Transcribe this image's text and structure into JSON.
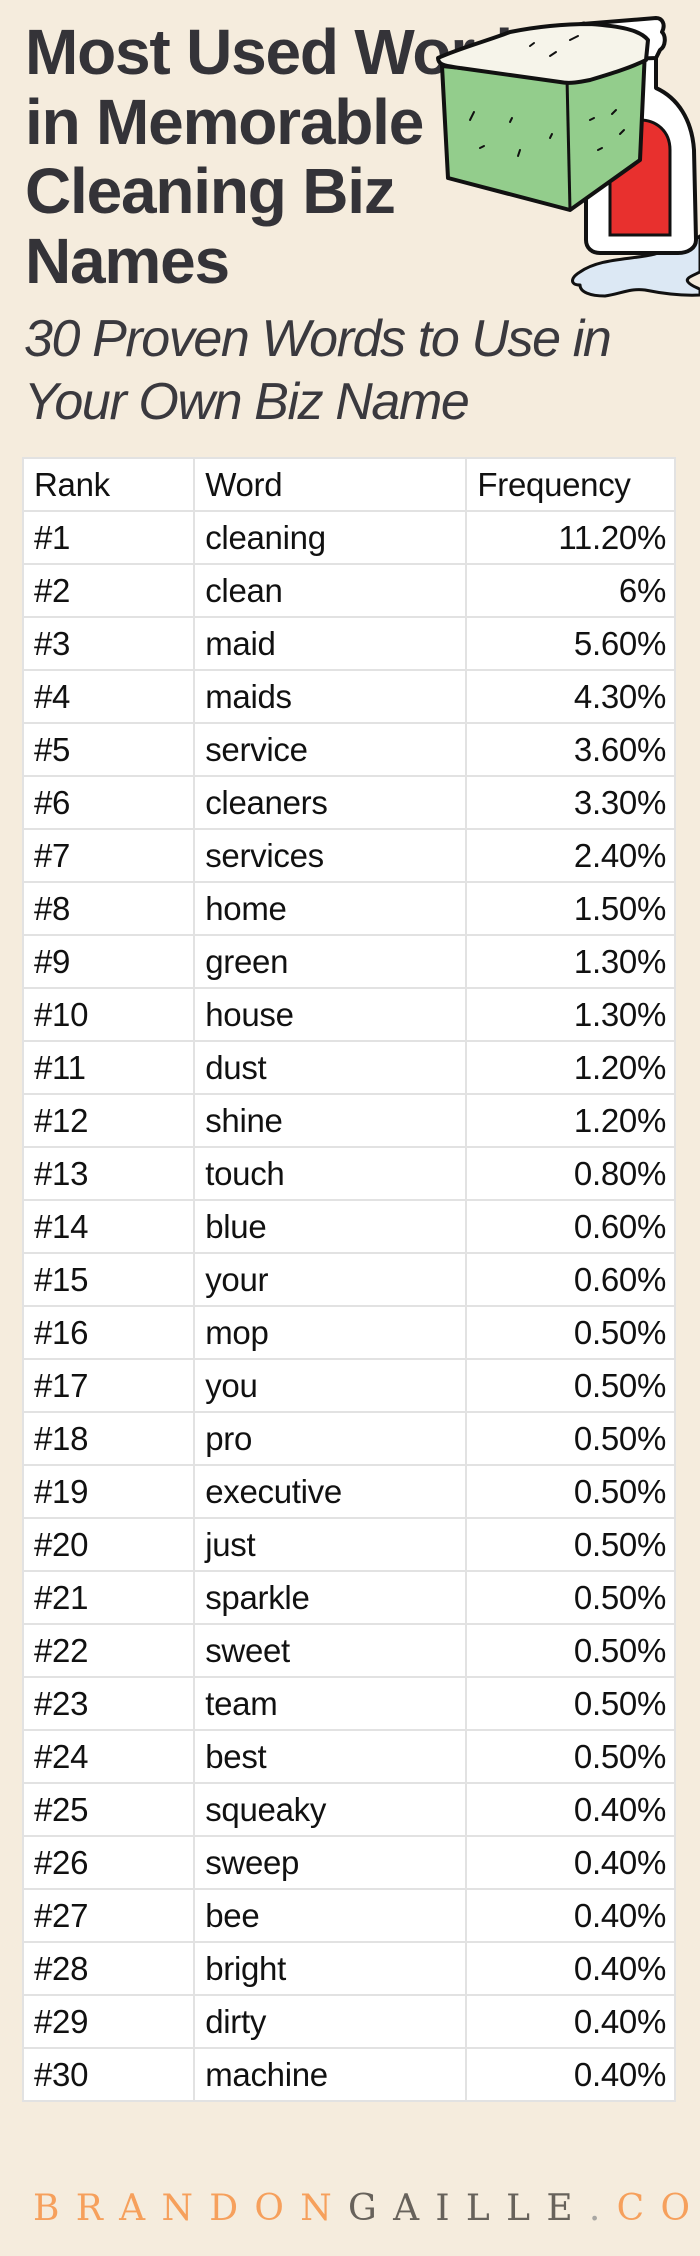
{
  "header": {
    "title_lines": [
      "Most Used Words",
      "in Memorable",
      "Cleaning Biz",
      "Names"
    ],
    "subtitle_lines": [
      "30 Proven Words to Use in",
      "Your Own Biz Name"
    ],
    "illustration": "spray-bottle-and-sponge"
  },
  "colors": {
    "background": "#f5ecdd",
    "title_text": "#343338",
    "brand_orange": "#f6a05c",
    "brand_gray": "#67625b",
    "sponge_green": "#93cd8c",
    "bottle_red": "#e8302e",
    "puddle_blue": "#dce8f4"
  },
  "table": {
    "columns": [
      "Rank",
      "Word",
      "Frequency"
    ],
    "rows": [
      {
        "rank": "#1",
        "word": "cleaning",
        "frequency": "11.20%"
      },
      {
        "rank": "#2",
        "word": "clean",
        "frequency": "6%"
      },
      {
        "rank": "#3",
        "word": "maid",
        "frequency": "5.60%"
      },
      {
        "rank": "#4",
        "word": "maids",
        "frequency": "4.30%"
      },
      {
        "rank": "#5",
        "word": "service",
        "frequency": "3.60%"
      },
      {
        "rank": "#6",
        "word": "cleaners",
        "frequency": "3.30%"
      },
      {
        "rank": "#7",
        "word": "services",
        "frequency": "2.40%"
      },
      {
        "rank": "#8",
        "word": "home",
        "frequency": "1.50%"
      },
      {
        "rank": "#9",
        "word": "green",
        "frequency": "1.30%"
      },
      {
        "rank": "#10",
        "word": "house",
        "frequency": "1.30%"
      },
      {
        "rank": "#11",
        "word": "dust",
        "frequency": "1.20%"
      },
      {
        "rank": "#12",
        "word": "shine",
        "frequency": "1.20%"
      },
      {
        "rank": "#13",
        "word": "touch",
        "frequency": "0.80%"
      },
      {
        "rank": "#14",
        "word": "blue",
        "frequency": "0.60%"
      },
      {
        "rank": "#15",
        "word": "your",
        "frequency": "0.60%"
      },
      {
        "rank": "#16",
        "word": "mop",
        "frequency": "0.50%"
      },
      {
        "rank": "#17",
        "word": "you",
        "frequency": "0.50%"
      },
      {
        "rank": "#18",
        "word": "pro",
        "frequency": "0.50%"
      },
      {
        "rank": "#19",
        "word": "executive",
        "frequency": "0.50%"
      },
      {
        "rank": "#20",
        "word": "just",
        "frequency": "0.50%"
      },
      {
        "rank": "#21",
        "word": "sparkle",
        "frequency": "0.50%"
      },
      {
        "rank": "#22",
        "word": "sweet",
        "frequency": "0.50%"
      },
      {
        "rank": "#23",
        "word": "team",
        "frequency": "0.50%"
      },
      {
        "rank": "#24",
        "word": "best",
        "frequency": "0.50%"
      },
      {
        "rank": "#25",
        "word": "squeaky",
        "frequency": "0.40%"
      },
      {
        "rank": "#26",
        "word": "sweep",
        "frequency": "0.40%"
      },
      {
        "rank": "#27",
        "word": "bee",
        "frequency": "0.40%"
      },
      {
        "rank": "#28",
        "word": "bright",
        "frequency": "0.40%"
      },
      {
        "rank": "#29",
        "word": "dirty",
        "frequency": "0.40%"
      },
      {
        "rank": "#30",
        "word": "machine",
        "frequency": "0.40%"
      }
    ]
  },
  "footer": {
    "brand_part1": "BRANDON",
    "brand_part2": "GAILLE",
    "brand_dot": ".",
    "brand_part3": "COM"
  }
}
